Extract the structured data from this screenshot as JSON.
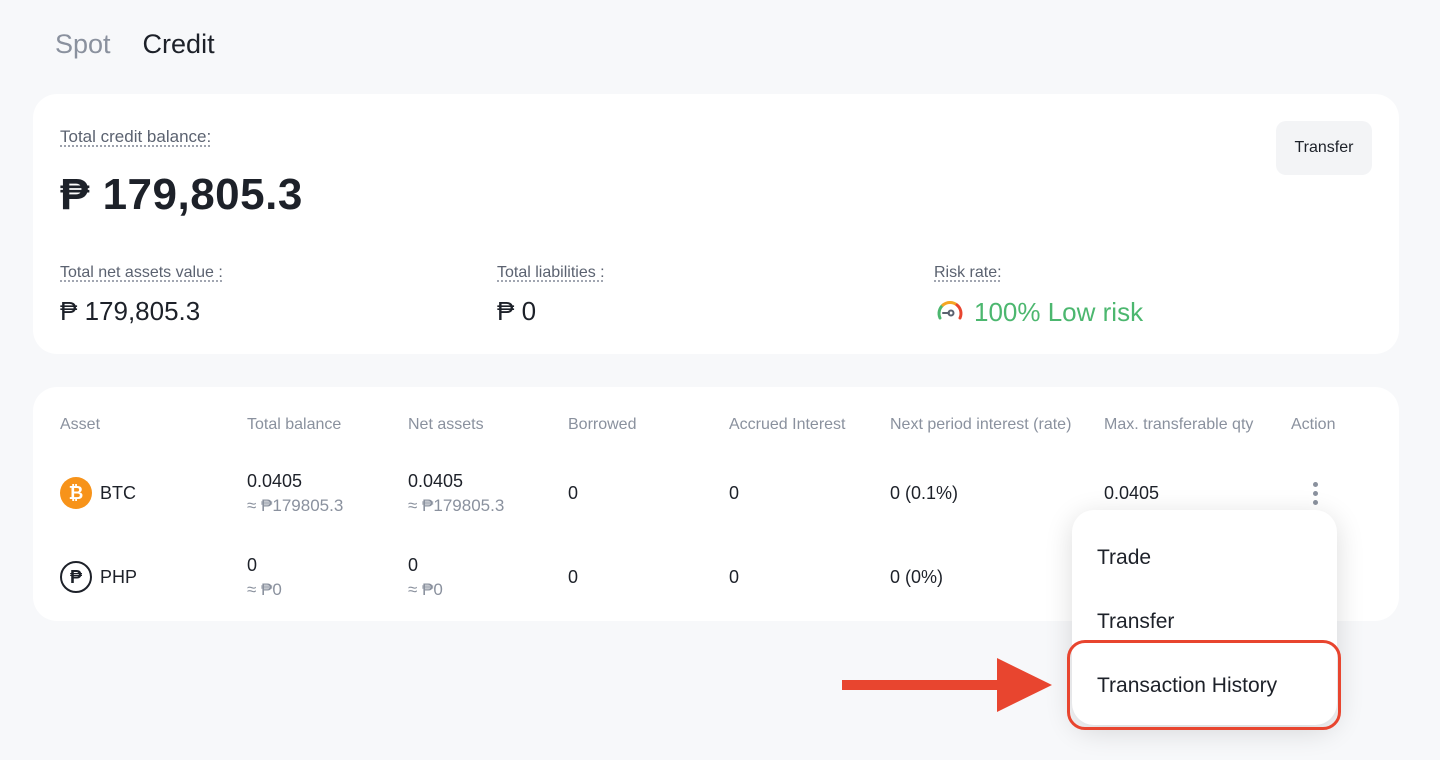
{
  "tabs": [
    {
      "label": "Spot",
      "active": false
    },
    {
      "label": "Credit",
      "active": true
    }
  ],
  "summary": {
    "total_label": "Total credit balance:",
    "total_value": "₱ 179,805.3",
    "transfer_label": "Transfer",
    "net_assets_label": "Total net assets value :",
    "net_assets_value": "₱ 179,805.3",
    "liabilities_label": "Total liabilities :",
    "liabilities_value": "₱ 0",
    "risk_label": "Risk rate:",
    "risk_value": "100% Low risk",
    "risk_color": "#4cb76f"
  },
  "table": {
    "headers": [
      "Asset",
      "Total balance",
      "Net assets",
      "Borrowed",
      "Accrued Interest",
      "Next period interest (rate)",
      "Max. transferable qty",
      "Action"
    ],
    "rows": [
      {
        "icon": "bitcoin-icon",
        "symbol": "BTC",
        "total": "0.0405",
        "total_sub": "≈ ₱179805.3",
        "net": "0.0405",
        "net_sub": "≈ ₱179805.3",
        "borrowed": "0",
        "accrued": "0",
        "next_interest": "0 (0.1%)",
        "max_transferable": "0.0405"
      },
      {
        "icon": "peso-icon",
        "symbol": "PHP",
        "total": "0",
        "total_sub": "≈ ₱0",
        "net": "0",
        "net_sub": "≈ ₱0",
        "borrowed": "0",
        "accrued": "0",
        "next_interest": "0 (0%)",
        "max_transferable": ""
      }
    ]
  },
  "menu": {
    "items": [
      "Trade",
      "Transfer",
      "Transaction History"
    ],
    "highlight_color": "#e8452f"
  },
  "icons": {
    "btc_glyph": "₿",
    "php_glyph": "₱"
  }
}
